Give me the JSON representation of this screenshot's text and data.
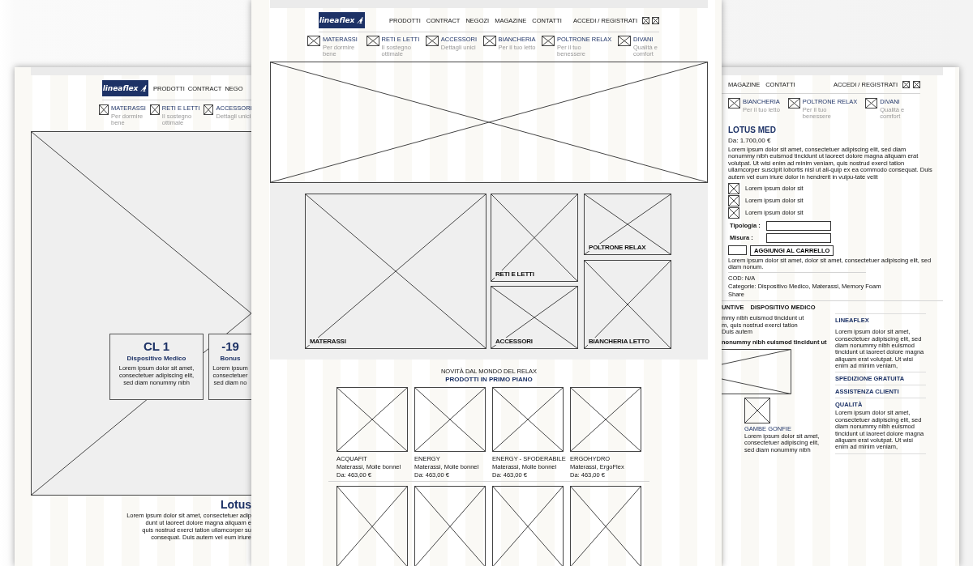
{
  "left_page": {
    "logo": "lineaflex",
    "nav": [
      "PRODOTTI",
      "CONTRACT",
      "NEGO"
    ],
    "categories": [
      {
        "title": "MATERASSI",
        "subtitle": "Per dormire bene"
      },
      {
        "title": "RETI E LETTI",
        "subtitle": "Il sostegno ottimale"
      },
      {
        "title": "ACCESSORI",
        "subtitle": "Dettagli unici"
      }
    ],
    "badges": [
      {
        "title": "CL 1",
        "subtitle": "Dispositivo Medico",
        "lines": [
          "Lorem ipsum dolor sit amet,",
          "consectetuer adipiscing elit,",
          "sed diam nonummy nibh"
        ]
      },
      {
        "title": "-19",
        "subtitle": "Bonus",
        "lines": [
          "Lorem ipsum",
          "consectetuer",
          "sed diam no"
        ]
      }
    ],
    "heading": "Lotus",
    "lines": [
      "Lorem ipsum dolor sit amet, consectetuer adip",
      "dunt ut laoreet dolore magna aliquam e",
      "quis nostrud exerci tation ullamcorper su",
      "consequat. Duis autem vel eum iriure"
    ]
  },
  "middle_page": {
    "logo": "lineaflex",
    "nav": [
      "PRODOTTI",
      "CONTRACT",
      "NEGOZI",
      "MAGAZINE",
      "CONTATTI"
    ],
    "account": "ACCEDI / REGISTRATI",
    "categories": [
      {
        "title": "MATERASSI",
        "subtitle": "Per dormire bene"
      },
      {
        "title": "RETI E LETTI",
        "subtitle": "Il sostegno ottimale"
      },
      {
        "title": "ACCESSORI",
        "subtitle": "Dettagli unici"
      },
      {
        "title": "BIANCHERIA",
        "subtitle": "Per il tuo letto"
      },
      {
        "title": "POLTRONE RELAX",
        "subtitle": "Per il tuo benessere"
      },
      {
        "title": "DIVANI",
        "subtitle": "Qualità e comfort"
      }
    ],
    "tiles": [
      {
        "label": "MATERASSI"
      },
      {
        "label": "RETI E LETTI"
      },
      {
        "label": "ACCESSORI"
      },
      {
        "label": "POLTRONE RELAX"
      },
      {
        "label": "BIANCHERIA LETTO"
      }
    ],
    "featured": {
      "eyebrow": "NOVITÀ DAL MONDO DEL RELAX",
      "title": "PRODOTTI IN PRIMO PIANO",
      "products": [
        {
          "name": "ACQUAFIT",
          "category": "Materassi, Molle bonnel",
          "price": "Da: 463,00 €"
        },
        {
          "name": "ENERGY",
          "category": "Materassi, Molle bonnel",
          "price": "Da: 463,00 €"
        },
        {
          "name": "ENERGY - SFODERABILE",
          "category": "Materassi, Molle bonnel",
          "price": "Da: 463,00 €"
        },
        {
          "name": "ERGOHYDRO",
          "category": "Materassi, ErgoFlex",
          "price": "Da: 463,00 €"
        }
      ]
    }
  },
  "right_page": {
    "nav": [
      "MAGAZINE",
      "CONTATTI"
    ],
    "account": "ACCEDI / REGISTRATI",
    "categories": [
      {
        "title": "BIANCHERIA",
        "subtitle": "Per il tuo letto"
      },
      {
        "title": "POLTRONE RELAX",
        "subtitle": "Per il tuo benessere"
      },
      {
        "title": "DIVANI",
        "subtitle": "Qualità e comfort"
      }
    ],
    "product": {
      "title": "LOTUS MED",
      "price": "Da: 1.700,00 €",
      "description": "Lorem ipsum dolor sit amet, consectetuer adipiscing elit, sed diam nonummy nibh euismod tincidunt ut laoreet dolore magna aliquam erat volutpat. Ut wisi enim ad minim veniam, quis nostrud exerci tation ullamcorper suscipit lobortis nisl ut ali-quip ex ea commodo consequat. Duis autem vel eum iriure dolor in hendrerit in vulpu-tate velit",
      "features": [
        "Lorem ipsum dolor sit",
        "Lorem ipsum dolor sit",
        "Lorem ipsum dolor sit"
      ],
      "fields": [
        {
          "label": "Tipologia :"
        },
        {
          "label": "Misura :"
        }
      ],
      "button": "AGGIUNGI AL CARRELLO",
      "note": "Lorem ipsum dolor sit amet, dolor sit amet, consectetuer adipiscing elit, sed diam nonum.",
      "meta": [
        "COD: N/A",
        "Categorie: Dispositivo Medico, Materassi, Memory Foam",
        "Share"
      ]
    },
    "tabs": [
      {
        "label": "UNTIVE"
      },
      {
        "label": "DISPOSITIVO MEDICO"
      }
    ],
    "body_lines": [
      "mmy nibh euismod tincidunt ut",
      "m, quis nostrud exerci tation",
      "Duis autem"
    ],
    "bold_line": "nonummy nibh euismod tincidunt ut",
    "gallery": {
      "title": "GAMBE GONFIE",
      "text": "Lorem ipsum dolor sit amet, consectetuer adipiscing elit, sed diam nonummy nibh"
    },
    "sidebar": [
      {
        "title": "LINEAFLEX",
        "text": "Lorem ipsum dolor sit amet, consectetuer adipiscing elit, sed diam nonummy nibh euismod tincidunt ut laoreet dolore magna aliquam erat volutpat. Ut wisi enim ad minim veniam,"
      },
      {
        "title": "SPEDIZIONE GRATUITA"
      },
      {
        "title": "ASSISTENZA CLIENTI"
      },
      {
        "title": "QUALITÀ",
        "text": "Lorem ipsum dolor sit amet, consectetuer adipiscing elit, sed diam nonummy nibh euismod tincidunt ut laoreet dolore magna aliquam erat volutpat. Ut wisi enim ad minim veniam,"
      }
    ]
  }
}
